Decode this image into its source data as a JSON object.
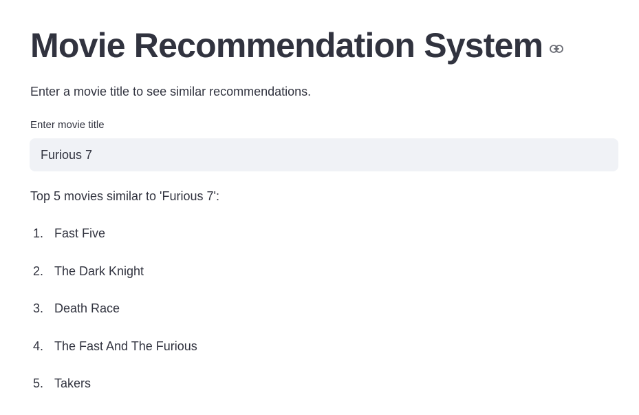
{
  "app": {
    "title": "Movie Recommendation System",
    "subtitle": "Enter a movie title to see similar recommendations."
  },
  "icons": {
    "title_anchor": "link-icon"
  },
  "search": {
    "label": "Enter movie title",
    "value": "Furious 7",
    "placeholder": ""
  },
  "results": {
    "header": "Top 5 movies similar to 'Furious 7':",
    "items": [
      {
        "number": "1.",
        "title": "Fast Five"
      },
      {
        "number": "2.",
        "title": "The Dark Knight"
      },
      {
        "number": "3.",
        "title": "Death Race"
      },
      {
        "number": "4.",
        "title": "The Fast And The Furious"
      },
      {
        "number": "5.",
        "title": "Takers"
      }
    ]
  },
  "colors": {
    "text": "#31333f",
    "input_background": "#f0f2f6",
    "page_background": "#ffffff",
    "icon": "#6b6d75"
  }
}
